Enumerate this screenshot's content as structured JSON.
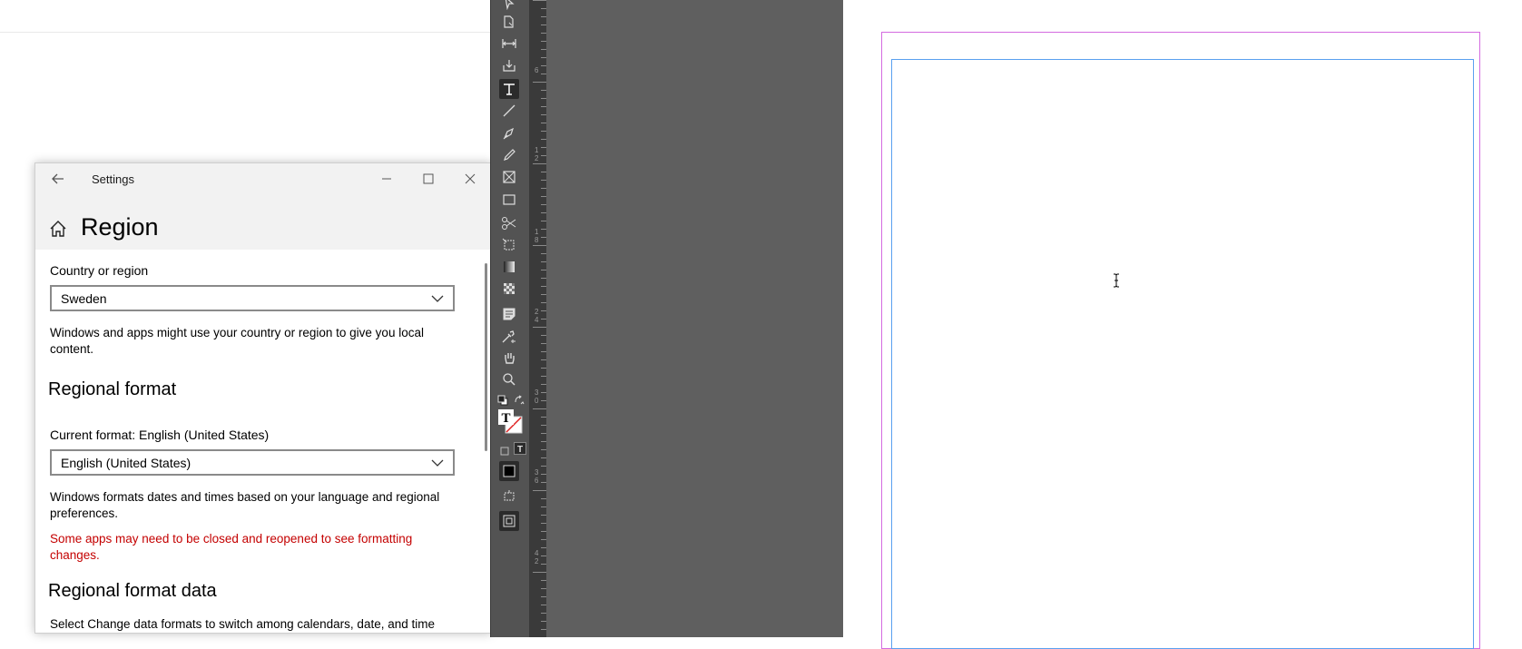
{
  "settings": {
    "window_title": "Settings",
    "page_title": "Region",
    "country": {
      "label": "Country or region",
      "value": "Sweden",
      "description": "Windows and apps might use your country or region to give you local content."
    },
    "regional_format": {
      "heading": "Regional format",
      "current_label": "Current format: English (United States)",
      "value": "English (United States)",
      "description": "Windows formats dates and times based on your language and regional preferences.",
      "warning": "Some apps may need to be closed and reopened to see formatting changes."
    },
    "regional_format_data": {
      "heading": "Regional format data",
      "description": "Select Change data formats to switch among calendars, date, and time"
    },
    "colors": {
      "warning": "#c40000",
      "title_bar": "#f2f2f2"
    }
  },
  "indesign": {
    "ruler_labels": [
      "6",
      "1 2",
      "1 8",
      "2 4",
      "3 0",
      "3 6",
      "4 2"
    ],
    "tools": [
      "selection-icon",
      "page-tool-icon",
      "gap-tool-icon",
      "content-collector-icon",
      "type-tool-icon",
      "line-tool-icon",
      "pen-tool-icon",
      "pencil-tool-icon",
      "rectangle-frame-icon",
      "rectangle-tool-icon",
      "scissors-icon",
      "free-transform-icon",
      "gradient-swatch-icon",
      "gradient-feather-icon",
      "note-tool-icon",
      "eyedropper-icon",
      "hand-tool-icon",
      "zoom-tool-icon"
    ],
    "colors": {
      "toolbar": "#535353",
      "pasteboard": "#5f5f5f",
      "page_border": "#d46be0",
      "margin_guide": "#5aa0f0"
    }
  }
}
